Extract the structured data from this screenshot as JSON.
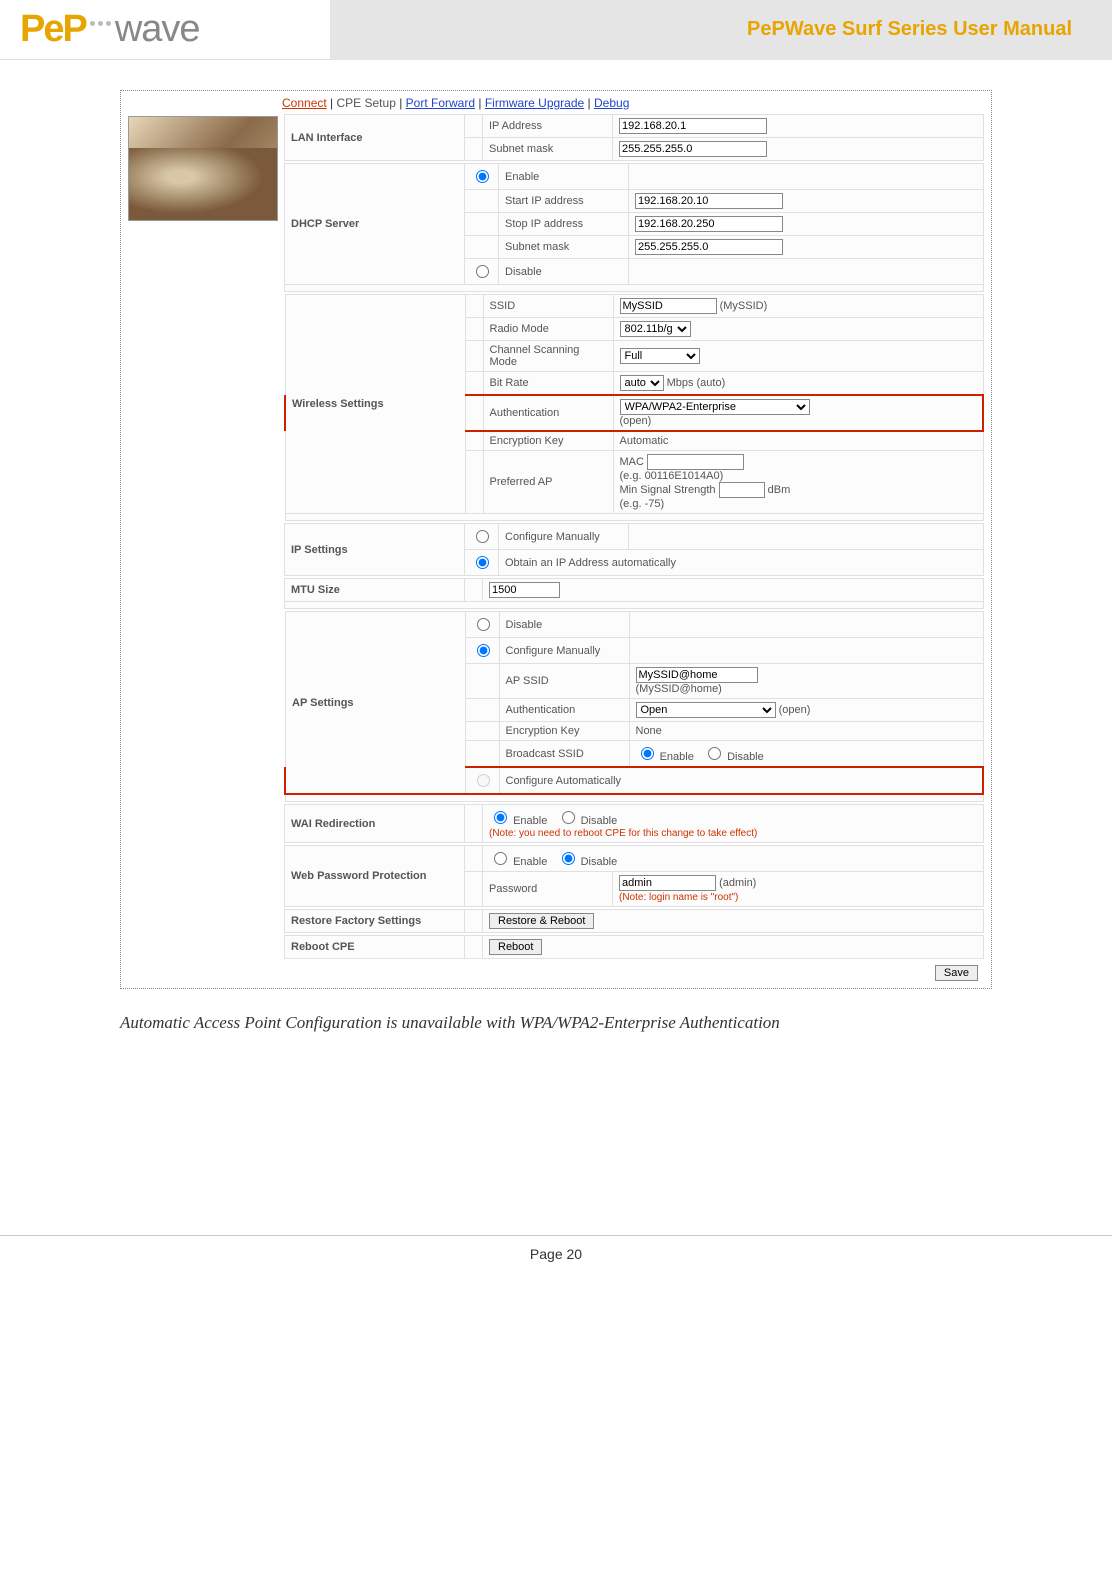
{
  "header": {
    "logo_pep": "PeP",
    "logo_wave": "wave",
    "title": "PePWave Surf Series User Manual"
  },
  "tabs": {
    "connect": "Connect",
    "cpe_setup": "CPE Setup",
    "port_forward": "Port Forward",
    "firmware_upgrade": "Firmware Upgrade",
    "debug": "Debug"
  },
  "lan": {
    "section": "LAN Interface",
    "ip_label": "IP Address",
    "ip_value": "192.168.20.1",
    "subnet_label": "Subnet mask",
    "subnet_value": "255.255.255.0"
  },
  "dhcp": {
    "section": "DHCP Server",
    "enable": "Enable",
    "start_label": "Start IP address",
    "start_value": "192.168.20.10",
    "stop_label": "Stop IP address",
    "stop_value": "192.168.20.250",
    "subnet_label": "Subnet mask",
    "subnet_value": "255.255.255.0",
    "disable": "Disable"
  },
  "wireless": {
    "section": "Wireless Settings",
    "ssid_label": "SSID",
    "ssid_value": "MySSID",
    "ssid_hint": "(MySSID)",
    "radio_label": "Radio Mode",
    "radio_value": "802.11b/g",
    "scan_label": "Channel Scanning Mode",
    "scan_value": "Full",
    "bitrate_label": "Bit Rate",
    "bitrate_value": "auto",
    "bitrate_hint": "Mbps (auto)",
    "auth_label": "Authentication",
    "auth_value": "WPA/WPA2-Enterprise",
    "auth_hint": "(open)",
    "enckey_label": "Encryption Key",
    "enckey_value": "Automatic",
    "prefap_label": "Preferred AP",
    "mac_label": "MAC",
    "mac_hint": "(e.g. 00116E1014A0)",
    "minsig_label": "Min Signal Strength",
    "minsig_unit": "dBm",
    "minsig_hint": "(e.g. -75)"
  },
  "ip": {
    "section": "IP Settings",
    "manual": "Configure Manually",
    "auto": "Obtain an IP Address automatically"
  },
  "mtu": {
    "section": "MTU Size",
    "value": "1500"
  },
  "ap": {
    "section": "AP Settings",
    "disable": "Disable",
    "manual": "Configure Manually",
    "ssid_label": "AP SSID",
    "ssid_value": "MySSID@home",
    "ssid_hint": "(MySSID@home)",
    "auth_label": "Authentication",
    "auth_value": "Open",
    "auth_hint": "(open)",
    "enckey_label": "Encryption Key",
    "enckey_value": "None",
    "bcast_label": "Broadcast SSID",
    "bcast_enable": "Enable",
    "bcast_disable": "Disable",
    "auto": "Configure Automatically"
  },
  "wai": {
    "section": "WAI Redirection",
    "enable": "Enable",
    "disable": "Disable",
    "note": "(Note: you need to reboot CPE for this change to take effect)"
  },
  "webpw": {
    "section": "Web Password Protection",
    "enable": "Enable",
    "disable": "Disable",
    "pw_label": "Password",
    "pw_value": "admin",
    "pw_hint": "(admin)",
    "note": "(Note: login name is \"root\")"
  },
  "restore": {
    "section": "Restore Factory Settings",
    "button": "Restore & Reboot"
  },
  "reboot": {
    "section": "Reboot CPE",
    "button": "Reboot"
  },
  "save": {
    "button": "Save"
  },
  "caption": "Automatic Access Point Configuration is unavailable with WPA/WPA2-Enterprise Authentication",
  "footer": "Page 20"
}
